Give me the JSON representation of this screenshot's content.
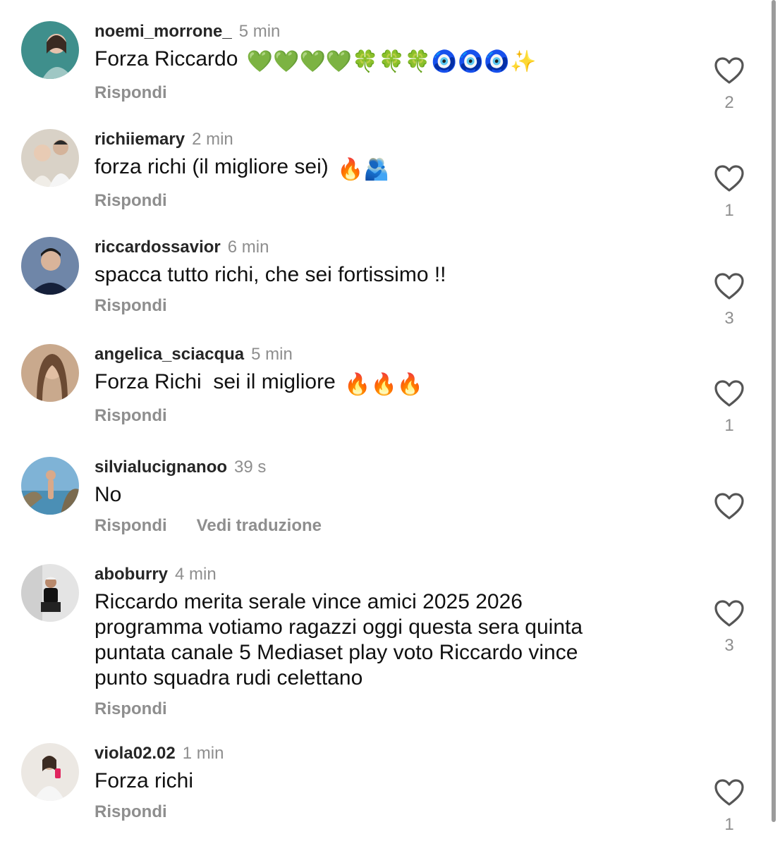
{
  "comments": [
    {
      "username": "noemi_morrone_",
      "time": "5 min",
      "text": "Forza Riccardo",
      "emoji": "💚💚💚💚🍀🍀🍀🧿🧿🧿✨",
      "reply": "Rispondi",
      "likes": "2"
    },
    {
      "username": "richiiemary",
      "time": "2 min",
      "text": "forza richi (il migliore sei)",
      "emoji": "🔥🫂",
      "reply": "Rispondi",
      "likes": "1"
    },
    {
      "username": "riccardossavior",
      "time": "6 min",
      "text": "spacca tutto richi, che sei fortissimo !!",
      "emoji": "",
      "reply": "Rispondi",
      "likes": "3"
    },
    {
      "username": "angelica_sciacqua",
      "time": "5 min",
      "text": "Forza Richi  sei il migliore",
      "emoji": "🔥🔥🔥",
      "reply": "Rispondi",
      "likes": "1"
    },
    {
      "username": "silvialucignanoo",
      "time": "39 s",
      "text": "No",
      "emoji": "",
      "reply": "Rispondi",
      "translate": "Vedi traduzione",
      "likes": ""
    },
    {
      "username": "aboburry",
      "time": "4 min",
      "text": "Riccardo merita serale vince amici 2025 2026\nprogramma votiamo ragazzi oggi questa sera quinta\npuntata canale 5 Mediaset play voto Riccardo vince\npunto squadra rudi celettano",
      "emoji": "",
      "reply": "Rispondi",
      "likes": "3"
    },
    {
      "username": "viola02.02",
      "time": "1 min",
      "text": "Forza richi",
      "emoji": "",
      "reply": "Rispondi",
      "likes": "1"
    }
  ]
}
